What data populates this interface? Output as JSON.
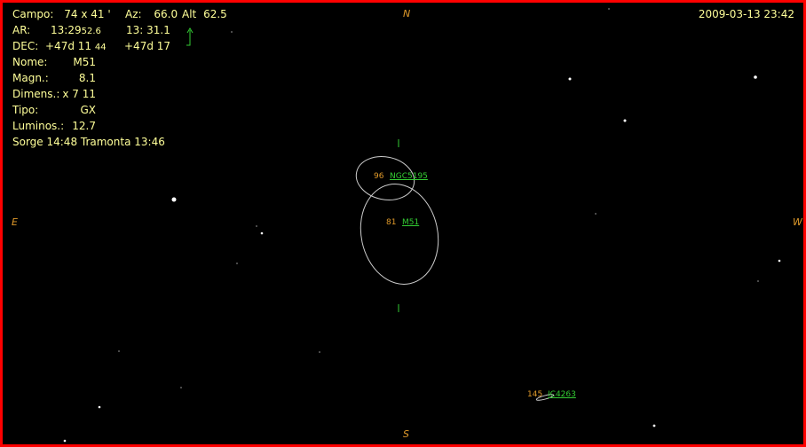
{
  "header": {
    "campo_label": "Campo:",
    "campo_value": "74  x   41 '",
    "az_label": "Az:",
    "az_value": "66.0",
    "alt_label": "Alt",
    "alt_value": "62.5",
    "datetime": "2009-03-13  23:42"
  },
  "coords": {
    "ar_label": "AR:",
    "ar_main": "13:29",
    "ar_small": "52.6",
    "ar_current": "13: 31.1",
    "dec_label": "DEC:",
    "dec_main": "+47d 11",
    "dec_small": "44",
    "dec_current": "+47d 17"
  },
  "object": {
    "nome_label": "Nome:",
    "nome_value": "M51",
    "magn_label": "Magn.:",
    "magn_value": "8.1",
    "dimens_label": "Dimens.:",
    "dimens_value": "11 x 7",
    "tipo_label": "Tipo:",
    "tipo_value": "GX",
    "lumin_label": "Luminos.:",
    "lumin_value": "12.7",
    "rise_set": "Sorge 14:48  Tramonta 13:46"
  },
  "compass": {
    "north": "N",
    "south": "S",
    "east": "E",
    "west": "W"
  },
  "objects": [
    {
      "num": "96",
      "name": "NGC5195"
    },
    {
      "num": "81",
      "name": "M51"
    },
    {
      "num": "145",
      "name": "IC4263"
    }
  ],
  "colors": {
    "frame": "#ff0000",
    "info_text": "#ffff99",
    "label_num": "#e09a2a",
    "label_name": "#33cc33",
    "ellipse": "#cccccc"
  },
  "icons": {
    "pointer": "up-arrow-icon"
  }
}
